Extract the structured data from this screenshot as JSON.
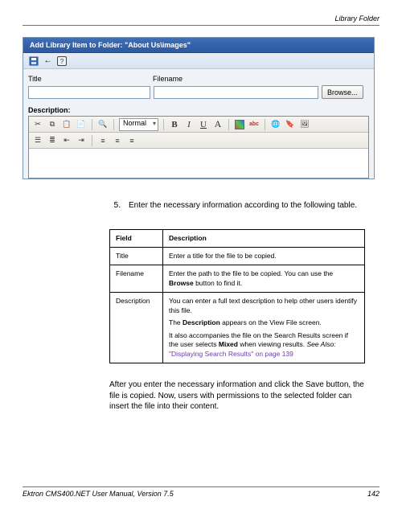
{
  "header": {
    "right": "Library Folder"
  },
  "cms": {
    "title": "Add Library Item to Folder: \"About Us\\images\"",
    "labels": {
      "title": "Title",
      "filename": "Filename",
      "description": "Description:"
    },
    "inputs": {
      "title_value": "",
      "filename_value": ""
    },
    "browse": "Browse...",
    "style_selected": "Normal"
  },
  "step": {
    "number": "5.",
    "text": "Enter the necessary information according to the following table."
  },
  "table": {
    "headers": {
      "field": "Field",
      "desc": "Description"
    },
    "rows": [
      {
        "field": "Title",
        "desc": "Enter a title for the file to be copied."
      },
      {
        "field": "Filename",
        "desc_parts": {
          "a": "Enter the path to the file to be copied. You can use the ",
          "b_strong": "Browse",
          "c": " button to find it."
        }
      },
      {
        "field": "Description",
        "desc_parts": {
          "p1": "You can enter a full text description to help other users identify this file.",
          "p2a": "The ",
          "p2b_strong": "Description",
          "p2c": " appears on the View File screen.",
          "p3a": "It also accompanies the file on the Search Results screen if the user selects ",
          "p3b_strong": "Mixed",
          "p3c": " when viewing results. ",
          "see_label": "See Also:",
          "see_link": " \"Displaying Search Results\" on page 139"
        }
      }
    ]
  },
  "after": "After you enter the necessary information and click the Save button, the file is copied. Now, users with permissions to the selected folder can insert the file into their content.",
  "footer": {
    "left": "Ektron CMS400.NET User Manual, Version 7.5",
    "page": "142"
  }
}
